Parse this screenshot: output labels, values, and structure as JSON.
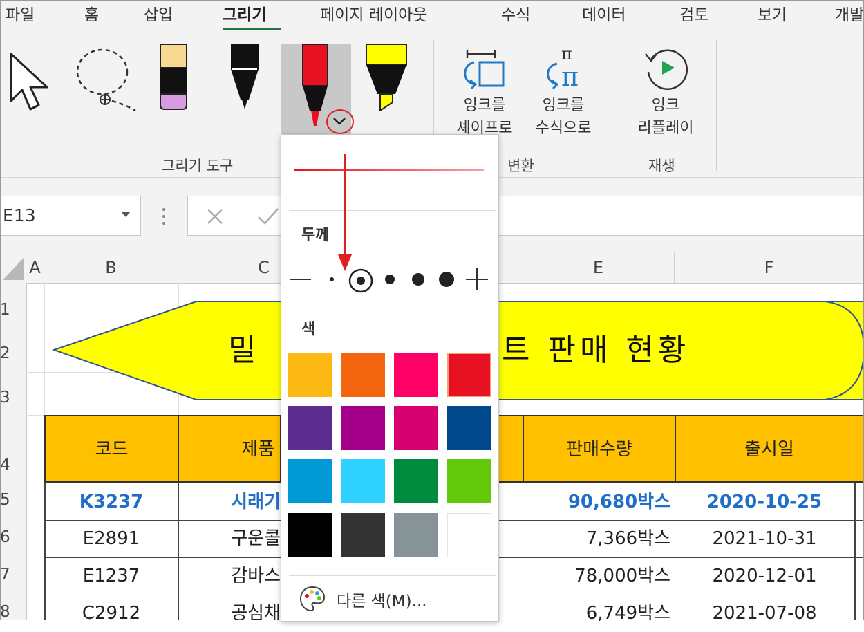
{
  "ribbon_tabs": [
    "파일",
    "홈",
    "삽입",
    "그리기",
    "페이지 레이아웃",
    "수식",
    "데이터",
    "검토",
    "보기",
    "개발"
  ],
  "active_tab": "그리기",
  "groups": {
    "drawing_tools": "그리기 도구",
    "convert": "변환",
    "replay": "재생"
  },
  "tools": {
    "ink_to_shape": [
      "잉크를",
      "셰이프로"
    ],
    "ink_to_math": [
      "잉크를",
      "수식으로"
    ],
    "ink_replay": [
      "잉크",
      "리플레이"
    ]
  },
  "name_box": "E13",
  "columns": [
    "A",
    "B",
    "C",
    "E",
    "F"
  ],
  "rows": [
    "1",
    "2",
    "3",
    "4",
    "5",
    "6",
    "7",
    "8"
  ],
  "banner": {
    "text": "밀크 판매 현황",
    "visible_left": "밀",
    "visible_right": "트 판매 현황"
  },
  "table": {
    "headers": [
      "코드",
      "제품",
      "판매수량",
      "출시일"
    ],
    "rows": [
      {
        "code": "K3237",
        "product": "시래기",
        "qty": "90,680박스",
        "date": "2020-10-25",
        "highlight": true
      },
      {
        "code": "E2891",
        "product": "구운콜",
        "qty": "7,366박스",
        "date": "2021-10-31",
        "highlight": false
      },
      {
        "code": "E1237",
        "product": "감바스",
        "qty": "78,000박스",
        "date": "2020-12-01",
        "highlight": false
      },
      {
        "code": "C2912",
        "product": "공심채",
        "qty": "6,749박스",
        "date": "2021-07-08",
        "highlight": false
      }
    ]
  },
  "dropdown": {
    "thickness_label": "두께",
    "color_label": "색",
    "more_colors": "다른 색(M)...",
    "thickness_selected_index": 1,
    "colors": [
      "#fdb913",
      "#f4650f",
      "#ff0066",
      "#e81123",
      "#5c2d91",
      "#a4008c",
      "#d6006e",
      "#004a8c",
      "#0099d6",
      "#2ed1ff",
      "#008b3e",
      "#62c90a",
      "#000000",
      "#333333",
      "#869497",
      "#ffffff"
    ],
    "selected_color": "#e81123"
  },
  "accent_colors": {
    "excel_green": "#217346",
    "header_fill": "#ffc000",
    "banner_fill": "#ffff00",
    "annotation_red": "#e02020"
  }
}
